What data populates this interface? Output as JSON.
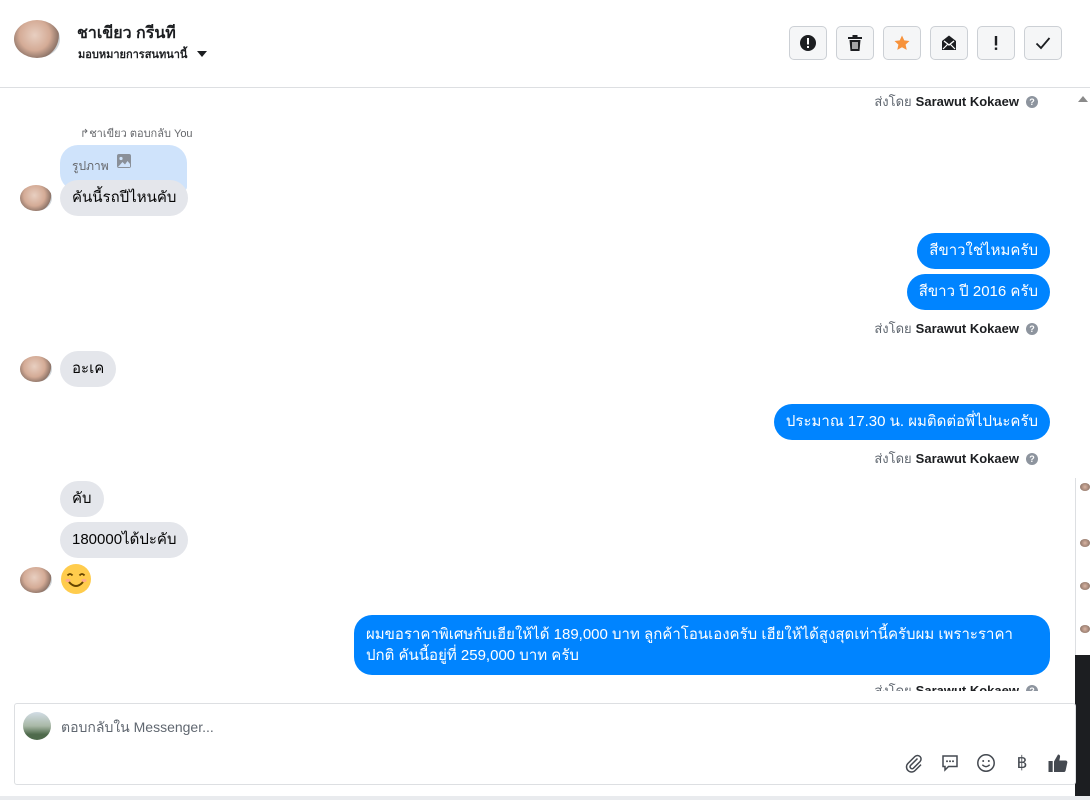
{
  "header": {
    "contact_name": "ชาเขียว กรีนที",
    "assign_label": "มอบหมายการสนทนานี้",
    "toolbar_icons": [
      "alert-circle-icon",
      "trash-icon",
      "star-icon",
      "mark-unread-icon",
      "exclamation-icon",
      "check-icon"
    ],
    "star_color": "#f7923b"
  },
  "thread": {
    "sent_by_prefix": "ส่งโดย",
    "sent_by_name": "Sarawut Kokaew",
    "help_glyph": "?",
    "reply_note": "ชาเขียว ตอบกลับ You",
    "reply_image_label": "รูปภาพ",
    "messages": [
      {
        "from": "customer",
        "text": "คันนี้รถปีไหนคับ"
      },
      {
        "from": "page",
        "text": "สีขาวใช่ไหมครับ"
      },
      {
        "from": "page",
        "text": "สีขาว ปี 2016 ครับ"
      },
      {
        "from": "customer",
        "text": "อะเค"
      },
      {
        "from": "page",
        "text": "ประมาณ 17.30 น. ผมติดต่อพี่ไปนะครับ"
      },
      {
        "from": "customer",
        "text": "คับ"
      },
      {
        "from": "customer",
        "text": "180000ได้ปะคับ"
      },
      {
        "from": "customer",
        "text": "😊"
      },
      {
        "from": "page",
        "text": "ผมขอราคาพิเศษกับเฮียให้ได้ 189,000 บาท ลูกค้าโอนเองครับ เฮียให้ได้สูงสุดเท่านี้ครับผม เพราะราคาปกติ คันนี้อยู่ที่ 259,000 บาท ครับ"
      }
    ],
    "bubble_in_color": "#e4e6eb",
    "bubble_out_color": "#0084ff"
  },
  "composer": {
    "placeholder": "ตอบกลับใน Messenger...",
    "tools": [
      "attach-icon",
      "saved-reply-icon",
      "emoji-icon",
      "baht-icon",
      "like-icon"
    ],
    "baht_glyph": "฿"
  }
}
